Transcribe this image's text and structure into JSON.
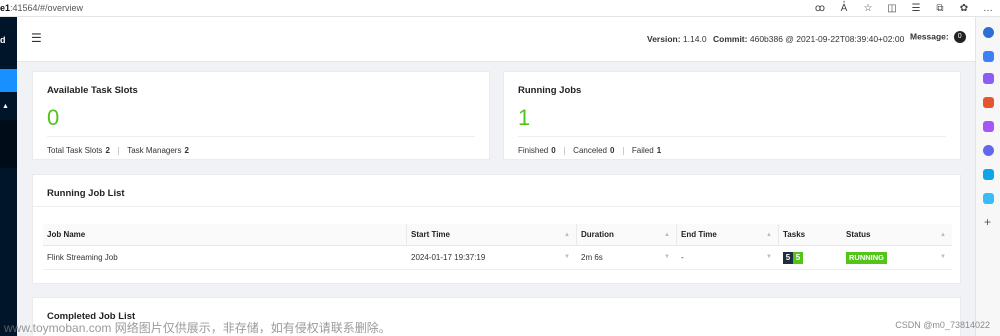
{
  "browser": {
    "url_host": "e1",
    "url_rest": ":41564/#/overview",
    "icons": [
      "reader-mode-icon",
      "read-aloud-icon",
      "favorite-star-icon",
      "split-screen-icon",
      "favorites-icon",
      "collections-icon",
      "extensions-icon"
    ],
    "more_label": "…"
  },
  "sidebar": {
    "logo_fragment": "d"
  },
  "header": {
    "version_label": "Version:",
    "version_value": "1.14.0",
    "commit_label": "Commit:",
    "commit_value": "460b386 @ 2021-09-22T08:39:40+02:00",
    "message_label": "Message:",
    "message_count": "0"
  },
  "task_slots": {
    "title": "Available Task Slots",
    "value": "0",
    "total_label": "Total Task Slots",
    "total_value": "2",
    "tm_label": "Task Managers",
    "tm_value": "2"
  },
  "running_jobs": {
    "title": "Running Jobs",
    "value": "1",
    "finished_label": "Finished",
    "finished_value": "0",
    "canceled_label": "Canceled",
    "canceled_value": "0",
    "failed_label": "Failed",
    "failed_value": "1"
  },
  "running_job_list": {
    "title": "Running Job List",
    "columns": [
      "Job Name",
      "Start Time",
      "Duration",
      "End Time",
      "Tasks",
      "Status"
    ],
    "rows": [
      {
        "name": "Flink Streaming Job",
        "start": "2024-01-17 19:37:19",
        "duration": "2m 6s",
        "end": "-",
        "tasks_total": "5",
        "tasks_running": "5",
        "status": "RUNNING"
      }
    ]
  },
  "completed_job_list": {
    "title": "Completed Job List"
  },
  "watermark": {
    "text": "www.toymoban.com 网络图片仅供展示，非存储，如有侵权请联系删除。",
    "csdn": "CSDN @m0_73814022"
  },
  "colors": {
    "accent": "#1890ff",
    "success": "#52c41a",
    "sidebar_bg": "#001529"
  }
}
